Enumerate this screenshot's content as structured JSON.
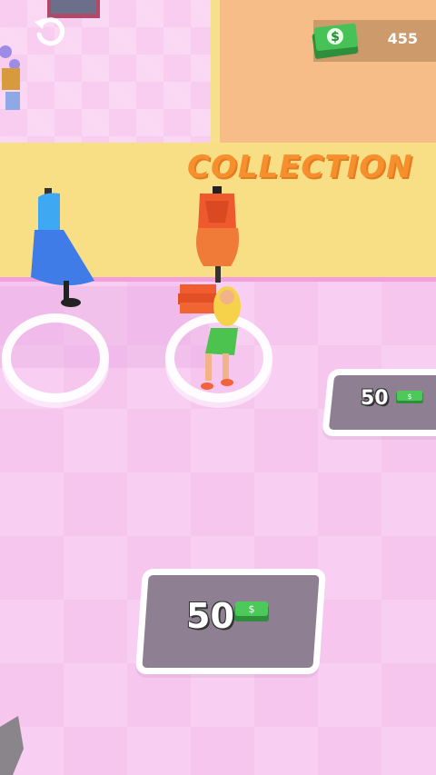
{
  "hud": {
    "money_amount": "455",
    "money_icon": "cash-stack-icon",
    "undo_icon": "undo-arrow-icon"
  },
  "store": {
    "section_title": "COLLECTION"
  },
  "unlock_pads": [
    {
      "price": "50",
      "icon": "cash-icon"
    },
    {
      "price": "50",
      "icon": "cash-icon"
    }
  ],
  "colors": {
    "floor": "#f7c6ef",
    "wall": "#f8df86",
    "title": "#f6902f",
    "pad": "#8f7f92",
    "cash": "#3cb54a"
  }
}
